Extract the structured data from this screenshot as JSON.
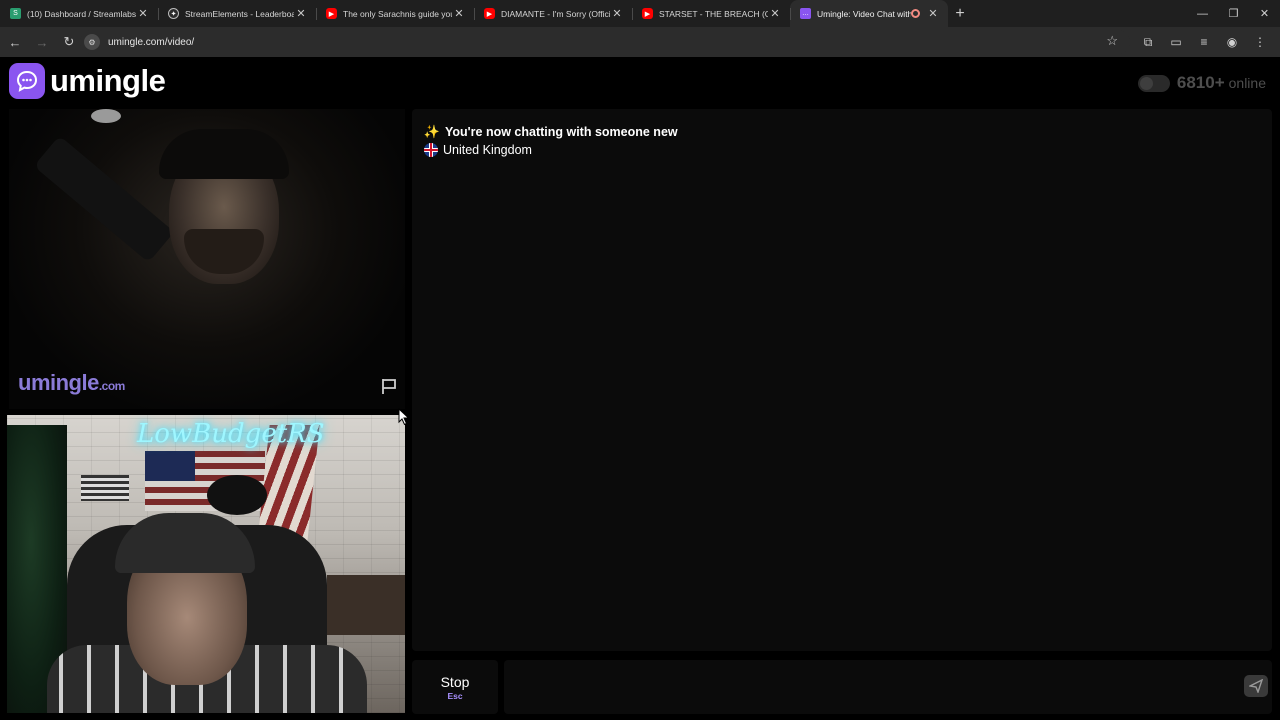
{
  "browser": {
    "tabs": [
      {
        "title": "(10) Dashboard / Streamlabs",
        "favicon": "streamlabs-icon",
        "color": "#2a9d6f"
      },
      {
        "title": "StreamElements - Leaderboard",
        "favicon": "streamelements-icon",
        "color": "#444444"
      },
      {
        "title": "The only Sarachnis guide you n",
        "favicon": "youtube-icon",
        "color": "#ff0000"
      },
      {
        "title": "DIAMANTE - I'm Sorry (Official",
        "favicon": "youtube-icon",
        "color": "#ff0000"
      },
      {
        "title": "STARSET - THE BREACH (Officia",
        "favicon": "youtube-icon",
        "color": "#ff0000"
      },
      {
        "title": "Umingle: Video Chat with S",
        "favicon": "umingle-icon",
        "color": "#8a55f0",
        "active": true
      }
    ],
    "url": "umingle.com/video/"
  },
  "site": {
    "logo_text": "umingle",
    "online_count": "6810+",
    "online_word": "online",
    "accent": "#8a55f0"
  },
  "video": {
    "watermark": "umingle",
    "watermark_suffix": ".com",
    "neon_sign": "LowBudgetRS"
  },
  "chat": {
    "new_chat_message": "You're now chatting with someone new",
    "country": "United Kingdom"
  },
  "controls": {
    "stop_label": "Stop",
    "stop_shortcut": "Esc",
    "message_placeholder": ""
  }
}
